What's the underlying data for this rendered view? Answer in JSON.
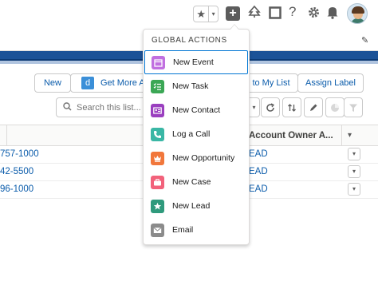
{
  "colors": {
    "brand_stripe": "#1b5297",
    "link": "#0b5cab",
    "focus": "#0176d3"
  },
  "header": {
    "favorites_icon": "star-icon",
    "global_actions_icon": "plus-icon",
    "help_icon": "question-icon",
    "setup_icon": "gear-icon",
    "notifications_icon": "bell-icon"
  },
  "toolbar": {
    "new_label": "New",
    "get_more_label": "Get More A",
    "d_icon_letter": "d",
    "add_to_list_label": "to My List",
    "assign_label": "Assign Label"
  },
  "search": {
    "placeholder": "Search this list..."
  },
  "table": {
    "owner_header": "Account Owner A...",
    "rows": [
      {
        "phone": "757-1000",
        "owner": "EAD"
      },
      {
        "phone": "42-5500",
        "owner": "EAD"
      },
      {
        "phone": "96-1000",
        "owner": "EAD"
      }
    ]
  },
  "global_actions": {
    "heading": "GLOBAL ACTIONS",
    "items": [
      {
        "label": "New Event",
        "icon": "calendar-icon",
        "color": "#c170e0"
      },
      {
        "label": "New Task",
        "icon": "task-list-icon",
        "color": "#3ba755"
      },
      {
        "label": "New Contact",
        "icon": "contact-card-icon",
        "color": "#9a3fbf"
      },
      {
        "label": "Log a Call",
        "icon": "phone-icon",
        "color": "#3ab7a5"
      },
      {
        "label": "New Opportunity",
        "icon": "crown-icon",
        "color": "#f1773b"
      },
      {
        "label": "New Case",
        "icon": "briefcase-icon",
        "color": "#f2627b"
      },
      {
        "label": "New Lead",
        "icon": "star-badge-icon",
        "color": "#2f9a7c"
      },
      {
        "label": "Email",
        "icon": "envelope-icon",
        "color": "#8b8b8b"
      }
    ]
  }
}
